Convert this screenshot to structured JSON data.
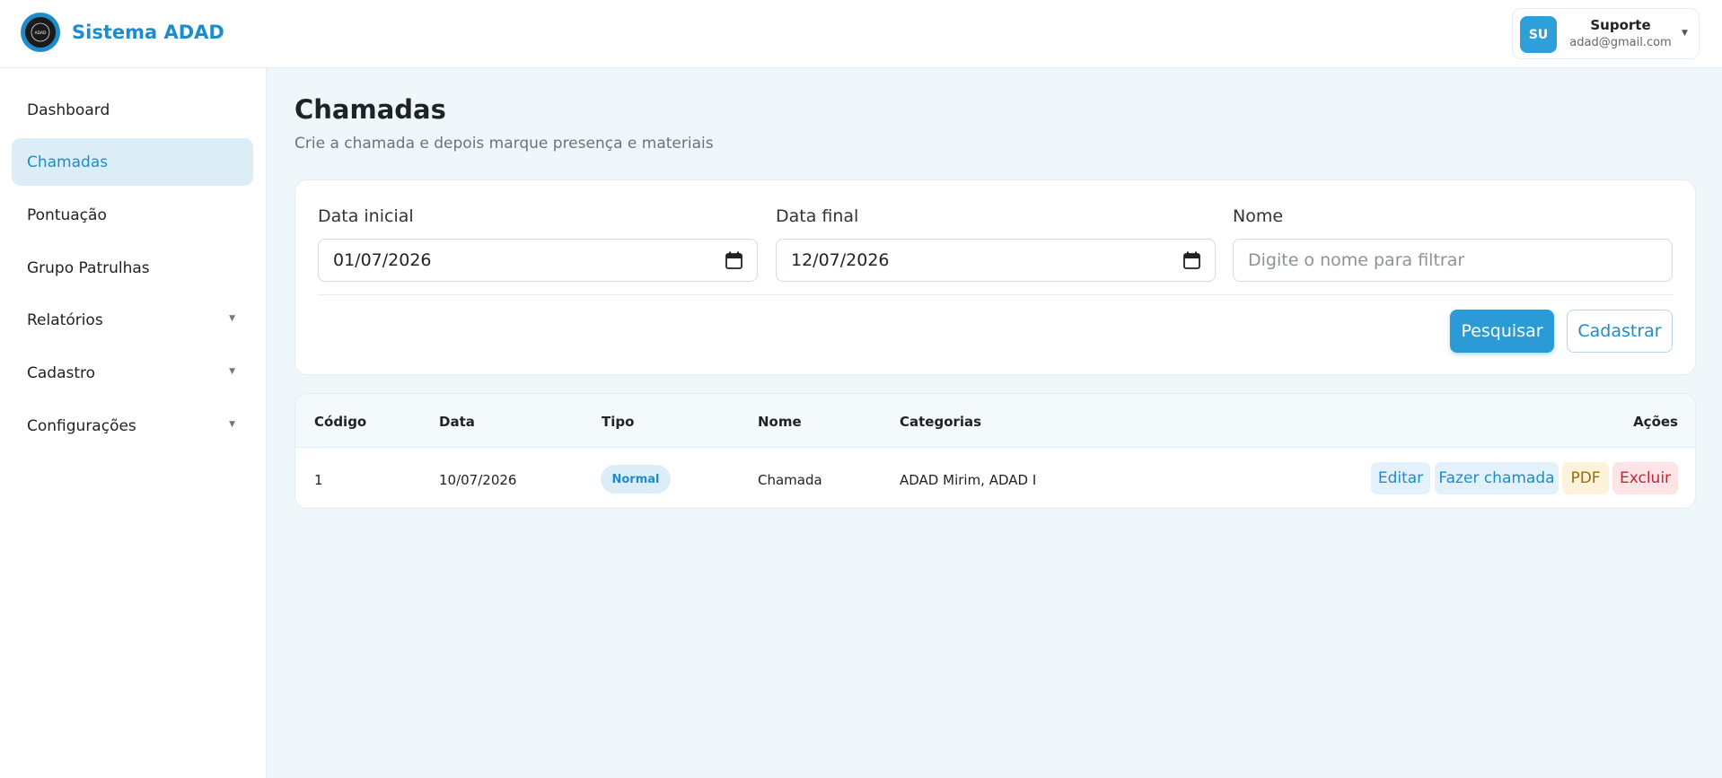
{
  "header": {
    "brand": "Sistema ADAD",
    "logo_text": "ADAD",
    "user": {
      "initials": "SU",
      "name": "Suporte",
      "email": "adad@gmail.com"
    }
  },
  "sidebar": {
    "items": [
      {
        "label": "Dashboard",
        "active": false,
        "has_submenu": false
      },
      {
        "label": "Chamadas",
        "active": true,
        "has_submenu": false
      },
      {
        "label": "Pontuação",
        "active": false,
        "has_submenu": false
      },
      {
        "label": "Grupo Patrulhas",
        "active": false,
        "has_submenu": false
      },
      {
        "label": "Relatórios",
        "active": false,
        "has_submenu": true
      },
      {
        "label": "Cadastro",
        "active": false,
        "has_submenu": true
      },
      {
        "label": "Configurações",
        "active": false,
        "has_submenu": true
      }
    ]
  },
  "page": {
    "title": "Chamadas",
    "subtitle": "Crie a chamada e depois marque presença e materiais"
  },
  "filters": {
    "start_label": "Data inicial",
    "start_value": "01/07/2026",
    "end_label": "Data final",
    "end_value": "12/07/2026",
    "name_label": "Nome",
    "name_placeholder": "Digite o nome para filtrar",
    "search_button": "Pesquisar",
    "create_button": "Cadastrar"
  },
  "table": {
    "columns": [
      "Código",
      "Data",
      "Tipo",
      "Nome",
      "Categorias",
      "Ações"
    ],
    "rows": [
      {
        "codigo": "1",
        "data": "10/07/2026",
        "tipo": "Normal",
        "nome": "Chamada",
        "categorias": "ADAD Mirim, ADAD I",
        "actions": {
          "edit": "Editar",
          "call": "Fazer chamada",
          "pdf": "PDF",
          "delete": "Excluir"
        }
      }
    ]
  },
  "colors": {
    "accent": "#1e8ccb",
    "primary_button": "#2a9bd6",
    "background": "#f0f7fb",
    "pdf": "#9a6b08",
    "delete": "#c0283a"
  }
}
